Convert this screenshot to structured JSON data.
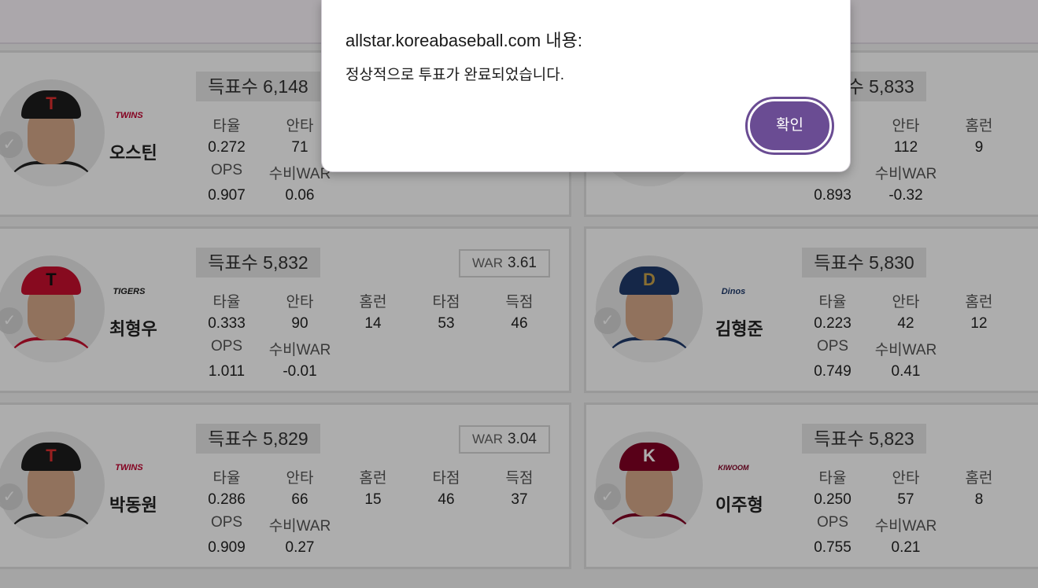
{
  "dialog": {
    "title": "allstar.koreabaseball.com 내용:",
    "message": "정상적으로 투표가 완료되었습니다.",
    "ok_label": "확인"
  },
  "colors": {
    "accent": "#6a4c93"
  },
  "stat_labels": {
    "avg": "타율",
    "hits": "안타",
    "hr": "홈런",
    "rbi": "타점",
    "runs": "득점",
    "ops": "OPS",
    "def_war": "수비WAR",
    "war": "WAR"
  },
  "players": [
    {
      "name": "오스틴",
      "team_logo": "TWINS",
      "votes": "득표수 6,148",
      "avg": "0.272",
      "hits": "71",
      "ops": "0.907",
      "def_war": "0.06"
    },
    {
      "votes": "득표수 5,833",
      "hits": "112",
      "hr": "9",
      "ops": "0.893",
      "def_war": "-0.32"
    },
    {
      "name": "최형우",
      "team_logo": "TIGERS",
      "votes": "득표수 5,832",
      "war": "3.61",
      "avg": "0.333",
      "hits": "90",
      "hr": "14",
      "rbi": "53",
      "runs": "46",
      "ops": "1.011",
      "def_war": "-0.01"
    },
    {
      "name": "김형준",
      "team_logo": "Dinos",
      "votes": "득표수 5,830",
      "avg": "0.223",
      "hits": "42",
      "hr": "12",
      "ops": "0.749",
      "def_war": "0.41"
    },
    {
      "name": "박동원",
      "team_logo": "TWINS",
      "votes": "득표수 5,829",
      "war": "3.04",
      "avg": "0.286",
      "hits": "66",
      "hr": "15",
      "rbi": "46",
      "runs": "37",
      "ops": "0.909",
      "def_war": "0.27"
    },
    {
      "name": "이주형",
      "team_logo": "KIWOOM",
      "votes": "득표수 5,823",
      "avg": "0.250",
      "hits": "57",
      "hr": "8",
      "ops": "0.755",
      "def_war": "0.21"
    }
  ]
}
